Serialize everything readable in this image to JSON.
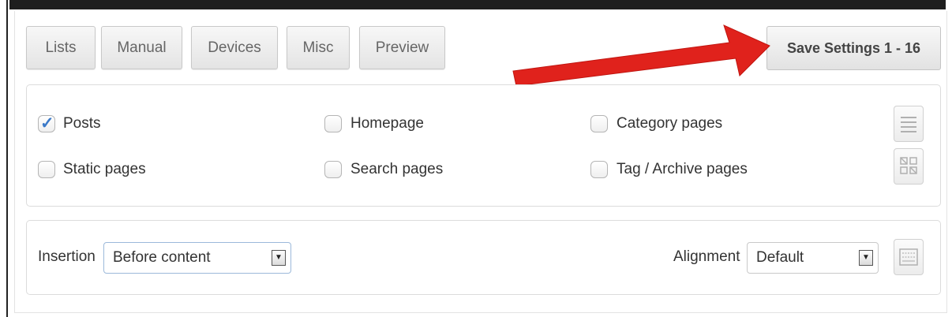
{
  "tabs": [
    {
      "label": "Lists"
    },
    {
      "label": "Manual"
    },
    {
      "label": "Devices"
    },
    {
      "label": "Misc"
    },
    {
      "label": "Preview"
    }
  ],
  "save_button": {
    "label": "Save Settings 1 - 16"
  },
  "checkboxes": {
    "posts": {
      "label": "Posts",
      "checked": true
    },
    "homepage": {
      "label": "Homepage",
      "checked": false
    },
    "category_pages": {
      "label": "Category pages",
      "checked": false
    },
    "static_pages": {
      "label": "Static pages",
      "checked": false
    },
    "search_pages": {
      "label": "Search pages",
      "checked": false
    },
    "tag_archive_pages": {
      "label": "Tag / Archive pages",
      "checked": false
    }
  },
  "insertion": {
    "label": "Insertion",
    "value": "Before content"
  },
  "alignment": {
    "label": "Alignment",
    "value": "Default"
  },
  "annotation": {
    "color": "#e0221c"
  },
  "icons": {
    "list_view": "list-icon",
    "grid_view": "grid-icon",
    "alignment_options": "keyboard-icon",
    "dropdown": "chevron-down-icon"
  }
}
